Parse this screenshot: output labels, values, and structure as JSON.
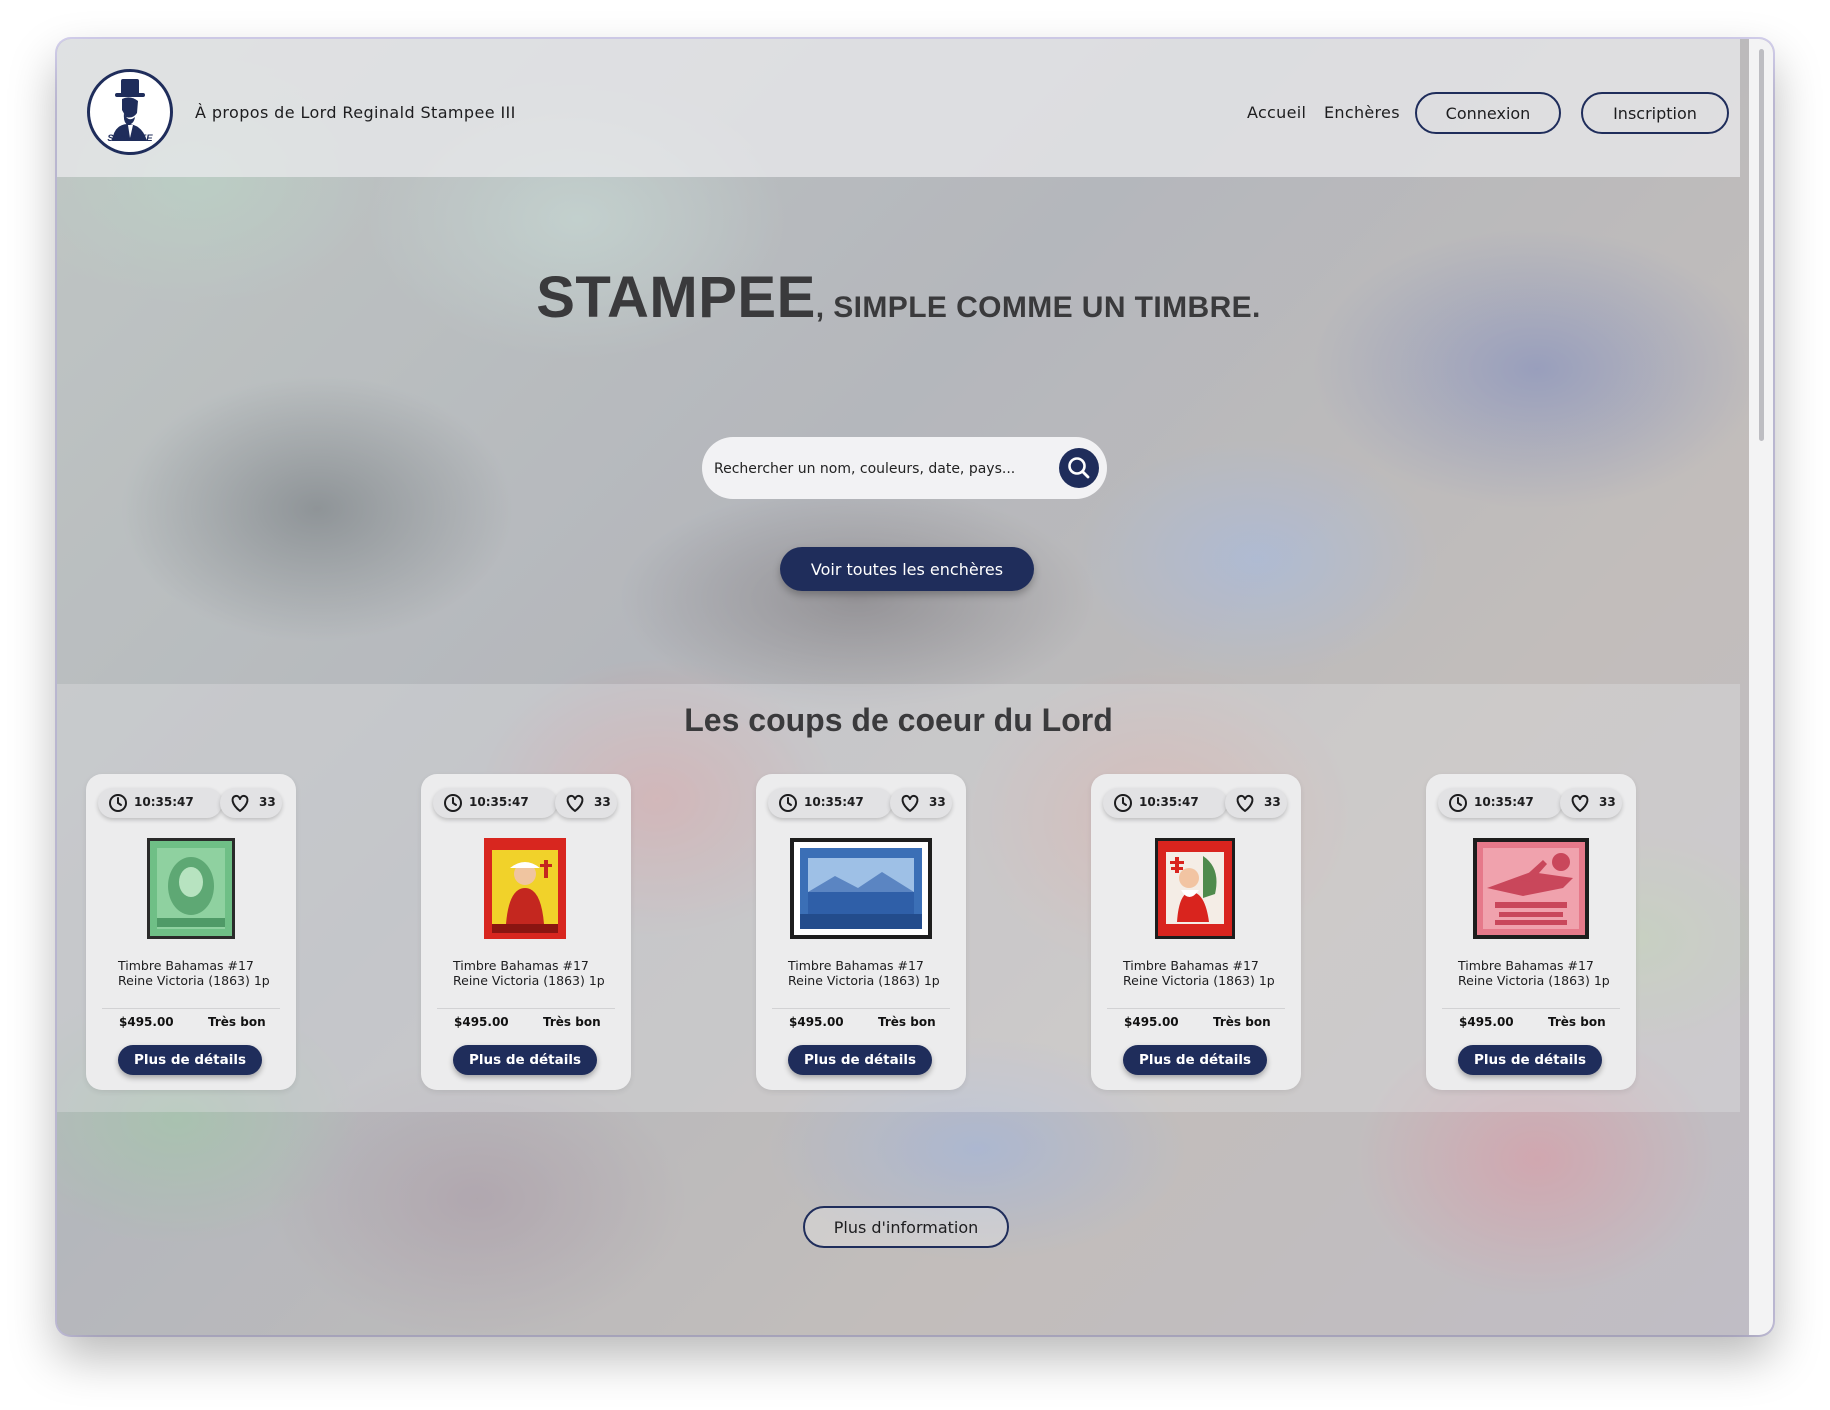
{
  "header": {
    "about_label": "À propos de Lord Reginald Stampee III",
    "nav": {
      "home": "Accueil",
      "auctions": "Enchères"
    },
    "login_label": "Connexion",
    "signup_label": "Inscription",
    "logo_text": "STAMPEE"
  },
  "hero": {
    "title_big": "STAMPEE",
    "title_rest": ", SIMPLE COMME UN TIMBRE.",
    "search_placeholder": "Rechercher un nom, couleurs, date, pays...",
    "all_auctions_label": "Voir toutes les enchères"
  },
  "featured": {
    "title": "Les coups de coeur du Lord",
    "cards": [
      {
        "timer": "10:35:47",
        "likes": "33",
        "title_line1": "Timbre Bahamas #17",
        "title_line2": "Reine Victoria (1863) 1p",
        "price": "$495.00",
        "condition": "Très bon",
        "button": "Plus de détails",
        "stamp": "green-king-stamp"
      },
      {
        "timer": "10:35:47",
        "likes": "33",
        "title_line1": "Timbre Bahamas #17",
        "title_line2": "Reine Victoria (1863) 1p",
        "price": "$495.00",
        "condition": "Très bon",
        "button": "Plus de détails",
        "stamp": "red-yellow-christmas-stamp"
      },
      {
        "timer": "10:35:47",
        "likes": "33",
        "title_line1": "Timbre Bahamas #17",
        "title_line2": "Reine Victoria (1863) 1p",
        "price": "$495.00",
        "condition": "Très bon",
        "button": "Plus de détails",
        "stamp": "blue-canada-landscape-stamp"
      },
      {
        "timer": "10:35:47",
        "likes": "33",
        "title_line1": "Timbre Bahamas #17",
        "title_line2": "Reine Victoria (1863) 1p",
        "price": "$495.00",
        "condition": "Très bon",
        "button": "Plus de détails",
        "stamp": "red-santa-seal-stamp"
      },
      {
        "timer": "10:35:47",
        "likes": "33",
        "title_line1": "Timbre Bahamas #17",
        "title_line2": "Reine Victoria (1863) 1p",
        "price": "$495.00",
        "condition": "Très bon",
        "button": "Plus de détails",
        "stamp": "pink-war-savings-stamp"
      }
    ]
  },
  "footer": {
    "more_info_label": "Plus d'information"
  },
  "colors": {
    "navy": "#1f2d5b",
    "card_bg": "#ececed",
    "text": "#1d1d1f"
  }
}
